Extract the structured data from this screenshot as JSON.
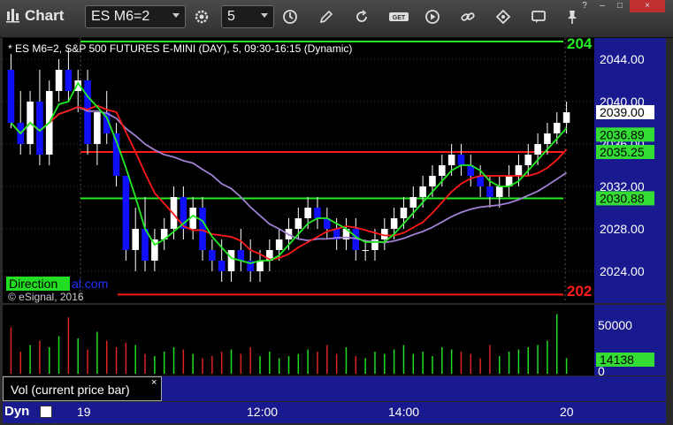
{
  "toolbar": {
    "title": "Chart",
    "symbol": "ES M6=2",
    "interval": "5",
    "icons": [
      "gear-icon",
      "clock-icon",
      "pencil-icon",
      "refresh-icon",
      "get-icon",
      "play-icon",
      "link-icon",
      "comment-icon",
      "pin-icon"
    ]
  },
  "window_buttons": [
    "?",
    "–",
    "□",
    "×"
  ],
  "chart": {
    "header": "* ES M6=2, S&P 500 FUTURES E-MINI (DAY), 5, 09:30-16:15 (Dynamic)",
    "watermark_label": "Direction",
    "watermark_text": "al.com",
    "copyright": "© eSignal, 2016",
    "price_ticks": [
      "2044.00",
      "2040.00",
      "2036.00",
      "2032.00",
      "2028.00",
      "2024.00"
    ],
    "price_tags": [
      {
        "text": "2039.00",
        "bg": "#ffffff",
        "fg": "#000000"
      },
      {
        "text": "2036.89",
        "bg": "#33dd33",
        "fg": "#000000"
      },
      {
        "text": "2035.25",
        "bg": "#33dd33",
        "fg": "#000000"
      },
      {
        "text": "2030.88",
        "bg": "#33dd33",
        "fg": "#000000"
      }
    ],
    "top_line_label": "204",
    "bottom_line_label": "202",
    "colors": {
      "up": "#ffffff",
      "down": "#1010ff",
      "red": "#ff1a1a",
      "green": "#22ee22",
      "purple": "#a080d0",
      "axis": "#1a1a90"
    }
  },
  "volume": {
    "tab_label": "Vol (current price bar)",
    "close": "×",
    "ticks": [
      "50000",
      "0"
    ],
    "current": "14138"
  },
  "time_axis": {
    "labels": [
      "19",
      "12:00",
      "14:00",
      "20"
    ],
    "dyn_label": "Dyn"
  },
  "chart_data": {
    "type": "candlestick",
    "ylim": [
      2021,
      2046
    ],
    "bars": [
      [
        2043,
        2044.5,
        2037.5,
        2038
      ],
      [
        2038,
        2041,
        2035,
        2036
      ],
      [
        2036,
        2041,
        2035,
        2040
      ],
      [
        2040,
        2043,
        2034,
        2035
      ],
      [
        2035,
        2042,
        2034,
        2041
      ],
      [
        2041,
        2044,
        2040,
        2043
      ],
      [
        2043,
        2045,
        2040,
        2041
      ],
      [
        2041,
        2043,
        2039,
        2042
      ],
      [
        2042,
        2043,
        2035,
        2036
      ],
      [
        2036,
        2039,
        2034,
        2039
      ],
      [
        2039,
        2041,
        2036,
        2037
      ],
      [
        2037,
        2038,
        2032,
        2033
      ],
      [
        2033,
        2033,
        2025,
        2026
      ],
      [
        2026,
        2030,
        2024,
        2028
      ],
      [
        2028,
        2031,
        2024,
        2025
      ],
      [
        2025,
        2028,
        2024,
        2027
      ],
      [
        2027,
        2029,
        2026,
        2028
      ],
      [
        2028,
        2032,
        2027,
        2031
      ],
      [
        2031,
        2032,
        2027,
        2028
      ],
      [
        2028,
        2031,
        2027,
        2030
      ],
      [
        2030,
        2031,
        2025,
        2026
      ],
      [
        2026,
        2027,
        2024,
        2025
      ],
      [
        2025,
        2027,
        2023,
        2024
      ],
      [
        2024,
        2026,
        2023,
        2026
      ],
      [
        2026,
        2028,
        2024,
        2025
      ],
      [
        2025,
        2027,
        2023,
        2024
      ],
      [
        2024,
        2026,
        2023,
        2025
      ],
      [
        2025,
        2027,
        2024,
        2026
      ],
      [
        2026,
        2028,
        2025,
        2027
      ],
      [
        2027,
        2029,
        2026,
        2028
      ],
      [
        2028,
        2030,
        2027,
        2029
      ],
      [
        2029,
        2031,
        2028,
        2030
      ],
      [
        2030,
        2031,
        2028,
        2029
      ],
      [
        2029,
        2030,
        2027,
        2028
      ],
      [
        2028,
        2029,
        2026,
        2027
      ],
      [
        2027,
        2029,
        2026,
        2028
      ],
      [
        2028,
        2029,
        2025,
        2026
      ],
      [
        2026,
        2027,
        2025,
        2026
      ],
      [
        2026,
        2028,
        2025,
        2027
      ],
      [
        2027,
        2029,
        2026,
        2028
      ],
      [
        2028,
        2030,
        2027,
        2029
      ],
      [
        2029,
        2031,
        2028,
        2030
      ],
      [
        2030,
        2032,
        2029,
        2031
      ],
      [
        2031,
        2033,
        2030,
        2032
      ],
      [
        2032,
        2034,
        2031,
        2033
      ],
      [
        2033,
        2035,
        2032,
        2034
      ],
      [
        2034,
        2036,
        2033,
        2035
      ],
      [
        2035,
        2036,
        2033,
        2034
      ],
      [
        2034,
        2035,
        2032,
        2033
      ],
      [
        2033,
        2034,
        2031,
        2032
      ],
      [
        2032,
        2033,
        2030,
        2031
      ],
      [
        2031,
        2033,
        2030,
        2032
      ],
      [
        2032,
        2034,
        2031,
        2033
      ],
      [
        2033,
        2035,
        2032,
        2034
      ],
      [
        2034,
        2036,
        2033,
        2035
      ],
      [
        2035,
        2037,
        2034,
        2036
      ],
      [
        2036,
        2038,
        2035,
        2037
      ],
      [
        2037,
        2039,
        2036,
        2038
      ],
      [
        2038,
        2040,
        2037,
        2039
      ]
    ],
    "volume": [
      42000,
      20000,
      26000,
      30000,
      24000,
      34000,
      51000,
      32000,
      22000,
      38000,
      30000,
      24000,
      28000,
      26000,
      18000,
      16000,
      20000,
      24000,
      22000,
      18000,
      14000,
      16000,
      20000,
      22000,
      18000,
      24000,
      16000,
      20000,
      14000,
      16000,
      18000,
      22000,
      20000,
      26000,
      18000,
      24000,
      16000,
      14000,
      20000,
      18000,
      22000,
      26000,
      18000,
      20000,
      16000,
      24000,
      22000,
      20000,
      18000,
      14000,
      26000,
      16000,
      20000,
      22000,
      24000,
      26000,
      30000,
      54000,
      14138
    ]
  }
}
